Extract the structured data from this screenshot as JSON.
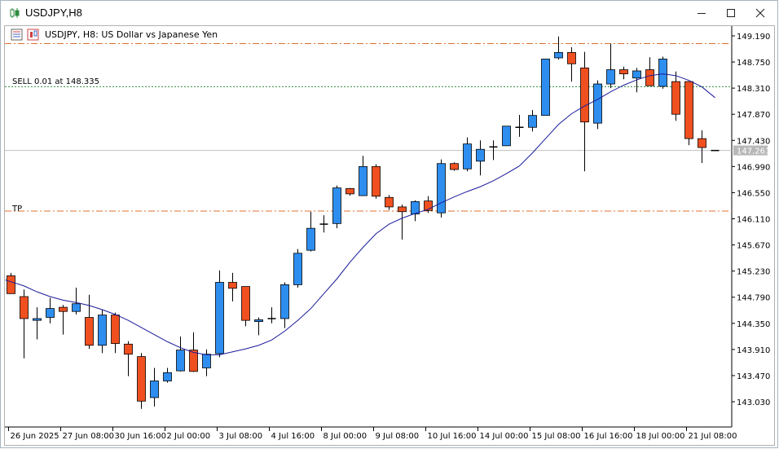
{
  "window": {
    "title": "USDJPY,H8",
    "controls": {
      "minimize": "—",
      "maximize": "☐",
      "close": "✕"
    }
  },
  "chart_header": {
    "label": "USDJPY, H8:  US Dollar vs Japanese Yen"
  },
  "trade_lines": {
    "sell_label": "SELL 0.01 at 148.335",
    "tp_label": "TP",
    "sell_price": 148.335,
    "tp_price": 146.24,
    "sl_price": 149.06,
    "current_price_label": "147.261",
    "current_price": 147.261
  },
  "colors": {
    "bull": "#2e8ef0",
    "bear": "#f05020",
    "wick": "#000000",
    "ma": "#1a1a9a",
    "tp_sl_line": "#e07030",
    "sell_line": "#2e8b3e",
    "price_line": "#c0c0c0",
    "price_tag": "#b8b8b8"
  },
  "chart_data": {
    "type": "candlestick",
    "symbol": "USDJPY",
    "timeframe": "H8",
    "ylim": [
      142.66,
      149.34
    ],
    "y_ticks": [
      "149.190",
      "148.750",
      "148.310",
      "147.870",
      "147.430",
      "146.990",
      "146.550",
      "146.110",
      "145.670",
      "145.230",
      "144.790",
      "144.350",
      "143.910",
      "143.470",
      "143.030"
    ],
    "x_ticks": [
      {
        "label": "26 Jun 2025",
        "index": 0
      },
      {
        "label": "27 Jun 08:00",
        "index": 4
      },
      {
        "label": "30 Jun 16:00",
        "index": 8
      },
      {
        "label": "2 Jul 00:00",
        "index": 12
      },
      {
        "label": "3 Jul 08:00",
        "index": 16
      },
      {
        "label": "4 Jul 16:00",
        "index": 20
      },
      {
        "label": "8 Jul 00:00",
        "index": 24
      },
      {
        "label": "9 Jul 08:00",
        "index": 28
      },
      {
        "label": "10 Jul 16:00",
        "index": 32
      },
      {
        "label": "14 Jul 00:00",
        "index": 36
      },
      {
        "label": "15 Jul 08:00",
        "index": 40
      },
      {
        "label": "16 Jul 16:00",
        "index": 44
      },
      {
        "label": "18 Jul 00:00",
        "index": 48
      },
      {
        "label": "21 Jul 08:00",
        "index": 52
      }
    ],
    "candles": [
      {
        "o": 145.15,
        "h": 145.2,
        "l": 144.85,
        "c": 144.85
      },
      {
        "o": 144.8,
        "h": 144.92,
        "l": 143.76,
        "c": 144.43
      },
      {
        "o": 144.4,
        "h": 144.62,
        "l": 144.08,
        "c": 144.43
      },
      {
        "o": 144.45,
        "h": 144.78,
        "l": 144.35,
        "c": 144.6
      },
      {
        "o": 144.62,
        "h": 144.66,
        "l": 144.16,
        "c": 144.55
      },
      {
        "o": 144.55,
        "h": 144.95,
        "l": 144.5,
        "c": 144.68
      },
      {
        "o": 144.45,
        "h": 144.83,
        "l": 143.92,
        "c": 143.98
      },
      {
        "o": 143.98,
        "h": 144.58,
        "l": 143.85,
        "c": 144.49
      },
      {
        "o": 144.49,
        "h": 144.53,
        "l": 143.85,
        "c": 144.01
      },
      {
        "o": 144.0,
        "h": 144.05,
        "l": 143.46,
        "c": 143.83
      },
      {
        "o": 143.79,
        "h": 143.85,
        "l": 142.91,
        "c": 143.04
      },
      {
        "o": 143.1,
        "h": 143.6,
        "l": 142.95,
        "c": 143.38
      },
      {
        "o": 143.38,
        "h": 143.6,
        "l": 143.35,
        "c": 143.52
      },
      {
        "o": 143.55,
        "h": 144.13,
        "l": 143.54,
        "c": 143.9
      },
      {
        "o": 143.9,
        "h": 144.2,
        "l": 143.53,
        "c": 143.54
      },
      {
        "o": 143.6,
        "h": 143.91,
        "l": 143.46,
        "c": 143.83
      },
      {
        "o": 143.84,
        "h": 145.24,
        "l": 143.78,
        "c": 145.04
      },
      {
        "o": 145.04,
        "h": 145.2,
        "l": 144.72,
        "c": 144.94
      },
      {
        "o": 144.97,
        "h": 144.97,
        "l": 144.3,
        "c": 144.4
      },
      {
        "o": 144.38,
        "h": 144.45,
        "l": 144.15,
        "c": 144.41
      },
      {
        "o": 144.43,
        "h": 144.62,
        "l": 144.35,
        "c": 144.43
      },
      {
        "o": 144.43,
        "h": 145.04,
        "l": 144.27,
        "c": 145.0
      },
      {
        "o": 145.0,
        "h": 145.6,
        "l": 144.95,
        "c": 145.53
      },
      {
        "o": 145.58,
        "h": 146.23,
        "l": 145.56,
        "c": 145.95
      },
      {
        "o": 146.02,
        "h": 146.17,
        "l": 145.88,
        "c": 146.02
      },
      {
        "o": 146.03,
        "h": 146.67,
        "l": 145.95,
        "c": 146.63
      },
      {
        "o": 146.62,
        "h": 146.63,
        "l": 146.5,
        "c": 146.53
      },
      {
        "o": 146.5,
        "h": 147.17,
        "l": 146.5,
        "c": 146.99
      },
      {
        "o": 146.99,
        "h": 147.03,
        "l": 146.45,
        "c": 146.49
      },
      {
        "o": 146.47,
        "h": 146.51,
        "l": 146.26,
        "c": 146.31
      },
      {
        "o": 146.31,
        "h": 146.35,
        "l": 145.76,
        "c": 146.23
      },
      {
        "o": 146.19,
        "h": 146.42,
        "l": 146.07,
        "c": 146.4
      },
      {
        "o": 146.41,
        "h": 146.49,
        "l": 146.21,
        "c": 146.25
      },
      {
        "o": 146.21,
        "h": 147.11,
        "l": 146.13,
        "c": 147.04
      },
      {
        "o": 147.04,
        "h": 147.06,
        "l": 146.92,
        "c": 146.94
      },
      {
        "o": 146.95,
        "h": 147.48,
        "l": 146.91,
        "c": 147.37
      },
      {
        "o": 147.08,
        "h": 147.43,
        "l": 146.84,
        "c": 147.28
      },
      {
        "o": 147.32,
        "h": 147.43,
        "l": 147.1,
        "c": 147.32
      },
      {
        "o": 147.34,
        "h": 147.67,
        "l": 147.34,
        "c": 147.67
      },
      {
        "o": 147.65,
        "h": 147.86,
        "l": 147.49,
        "c": 147.65
      },
      {
        "o": 147.65,
        "h": 147.94,
        "l": 147.58,
        "c": 147.85
      },
      {
        "o": 147.85,
        "h": 148.8,
        "l": 147.85,
        "c": 148.8
      },
      {
        "o": 148.82,
        "h": 149.18,
        "l": 148.79,
        "c": 148.91
      },
      {
        "o": 148.91,
        "h": 149.0,
        "l": 148.42,
        "c": 148.72
      },
      {
        "o": 148.65,
        "h": 148.92,
        "l": 146.91,
        "c": 147.74
      },
      {
        "o": 147.72,
        "h": 148.44,
        "l": 147.62,
        "c": 148.38
      },
      {
        "o": 148.38,
        "h": 149.06,
        "l": 148.31,
        "c": 148.62
      },
      {
        "o": 148.62,
        "h": 148.67,
        "l": 148.46,
        "c": 148.55
      },
      {
        "o": 148.48,
        "h": 148.65,
        "l": 148.24,
        "c": 148.6
      },
      {
        "o": 148.62,
        "h": 148.83,
        "l": 148.35,
        "c": 148.35
      },
      {
        "o": 148.34,
        "h": 148.84,
        "l": 148.3,
        "c": 148.8
      },
      {
        "o": 148.42,
        "h": 148.59,
        "l": 147.76,
        "c": 147.87
      },
      {
        "o": 148.42,
        "h": 148.42,
        "l": 147.35,
        "c": 147.46
      },
      {
        "o": 147.46,
        "h": 147.6,
        "l": 147.05,
        "c": 147.31
      },
      {
        "o": 147.26,
        "h": 147.26,
        "l": 147.26,
        "c": 147.26
      }
    ],
    "ma_period_note": "",
    "ma": [
      145.08,
      144.98,
      144.88,
      144.8,
      144.74,
      144.7,
      144.65,
      144.58,
      144.5,
      144.4,
      144.28,
      144.16,
      144.04,
      143.94,
      143.86,
      143.82,
      143.82,
      143.87,
      143.92,
      143.98,
      144.07,
      144.22,
      144.4,
      144.6,
      144.85,
      145.1,
      145.38,
      145.63,
      145.86,
      146.02,
      146.12,
      146.2,
      146.27,
      146.38,
      146.48,
      146.57,
      146.65,
      146.75,
      146.87,
      147.0,
      147.22,
      147.46,
      147.7,
      147.88,
      148.01,
      148.12,
      148.25,
      148.36,
      148.45,
      148.52,
      148.55,
      148.52,
      148.44,
      148.33,
      148.15
    ]
  }
}
